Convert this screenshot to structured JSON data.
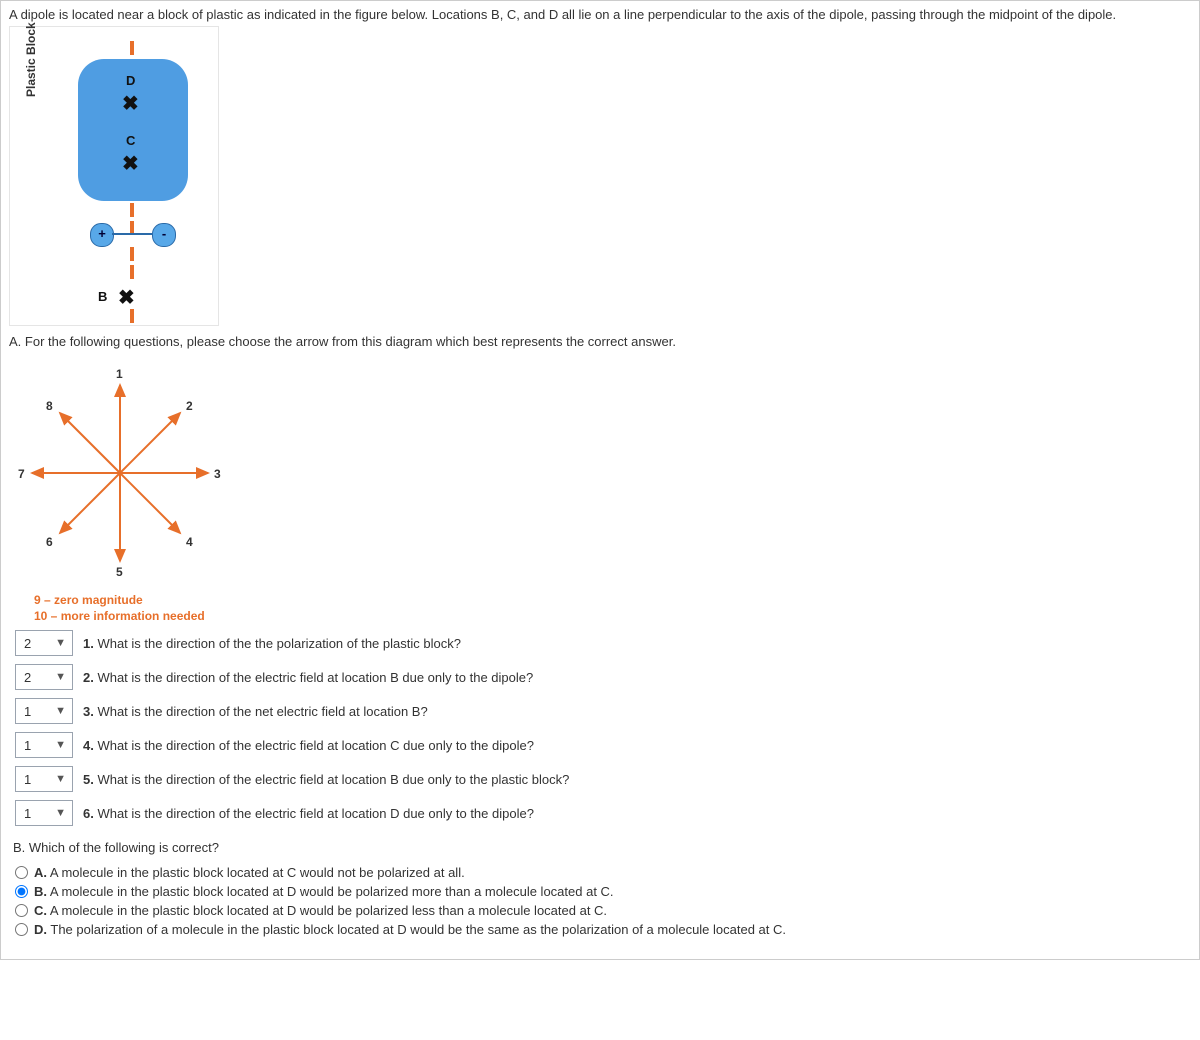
{
  "intro": "A dipole is located near a block of plastic as indicated in the figure below. Locations B, C, and D all lie on a line perpendicular to the axis of the dipole, passing through the midpoint of the dipole.",
  "fig": {
    "block_label": "Plastic Block",
    "point_B": "B",
    "point_C": "C",
    "point_D": "D",
    "plus": "+",
    "minus": "-",
    "x": "✖"
  },
  "sectionA_prompt": "A. For the following questions, please choose the arrow from this diagram which best represents the correct answer.",
  "arrows": {
    "n1": "1",
    "n2": "2",
    "n3": "3",
    "n4": "4",
    "n5": "5",
    "n6": "6",
    "n7": "7",
    "n8": "8"
  },
  "legend9": "9 – zero magnitude",
  "legend10": "10 – more information needed",
  "questions": [
    {
      "sel": "2",
      "num": "1.",
      "text": " What is the direction of the the polarization of the plastic block?"
    },
    {
      "sel": "2",
      "num": "2.",
      "text": " What is the direction of the electric field at location B due only to the dipole?"
    },
    {
      "sel": "1",
      "num": "3.",
      "text": " What is the direction of the net electric field at location B?"
    },
    {
      "sel": "1",
      "num": "4.",
      "text": " What is the direction of the electric field at location C due only to the dipole?"
    },
    {
      "sel": "1",
      "num": "5.",
      "text": " What is the direction of the electric field at location B due only to the plastic block?"
    },
    {
      "sel": "1",
      "num": "6.",
      "text": " What is the direction of the electric field at location D due only to the dipole?"
    }
  ],
  "sectionB_prompt": "B. Which of the following is correct?",
  "options": [
    {
      "key": "A.",
      "text": " A molecule in the plastic block located at C would not be polarized at all.",
      "checked": false
    },
    {
      "key": "B.",
      "text": " A molecule in the plastic block located at D would be polarized more than a molecule located at C.",
      "checked": true
    },
    {
      "key": "C.",
      "text": " A molecule in the plastic block located at D would be polarized less than a molecule located at C.",
      "checked": false
    },
    {
      "key": "D.",
      "text": " The polarization of a molecule in the plastic block located at D would be the same as the polarization of a molecule located at C.",
      "checked": false
    }
  ]
}
